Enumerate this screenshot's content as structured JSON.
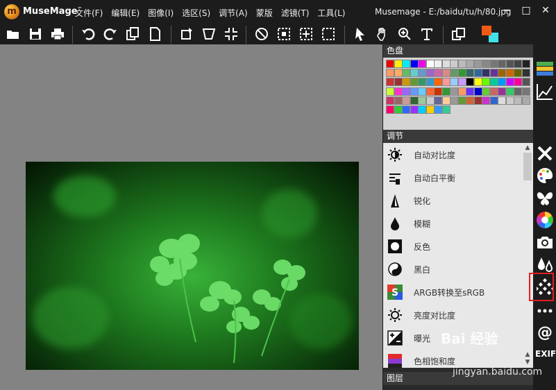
{
  "app": {
    "brand": "MuseMage",
    "tm": "™",
    "logo_letter": "m",
    "window_title": "Musemage - E:/baidu/tu/h/80.jpg"
  },
  "menu": [
    "文件(F)",
    "编辑(E)",
    "图像(I)",
    "选区(S)",
    "调节(A)",
    "蒙版",
    "滤镜(T)",
    "工具(L)"
  ],
  "window_buttons": [
    "minimize-icon",
    "maximize-icon",
    "close-icon"
  ],
  "toolbar_icons": [
    "open-folder-icon",
    "save-icon",
    "print-icon",
    "undo-icon",
    "redo-icon",
    "copy-icon",
    "paste-icon",
    "rotate-icon",
    "transform-icon",
    "resize-icon",
    "deselect-icon",
    "rect-select-icon",
    "move-select-icon",
    "crop-select-icon",
    "pointer-icon",
    "hand-icon",
    "zoom-icon",
    "text-icon",
    "layers-copy-icon",
    "color-swap-icon"
  ],
  "colors": {
    "foreground": "#f05a14",
    "background": "#41e1ec",
    "accent_active": "#e02020"
  },
  "palette_header": "色盘",
  "adjust_header": "调节",
  "layers_header": "图层",
  "adjustments": [
    {
      "label": "自动对比度",
      "icon": "auto-contrast-icon"
    },
    {
      "label": "自动白平衡",
      "icon": "white-balance-icon"
    },
    {
      "label": "锐化",
      "icon": "sharpen-icon"
    },
    {
      "label": "模糊",
      "icon": "blur-icon"
    },
    {
      "label": "反色",
      "icon": "invert-icon"
    },
    {
      "label": "黑白",
      "icon": "black-white-icon"
    },
    {
      "label": "ARGB转换至sRGB",
      "icon": "argb-srgb-icon"
    },
    {
      "label": "亮度对比度",
      "icon": "brightness-contrast-icon"
    },
    {
      "label": "曝光",
      "icon": "exposure-icon"
    },
    {
      "label": "色相饱和度",
      "icon": "hue-saturation-icon"
    }
  ],
  "right_sidebar": [
    "palette-tab-icon",
    "curve-icon",
    "tools-icon",
    "palette-art-icon",
    "butterfly-icon",
    "color-wheel-icon",
    "camera-icon",
    "drops-icon",
    "pattern-icon",
    "more-icon",
    "at-icon"
  ],
  "exif_label": "EXIF",
  "watermark": {
    "text": "Bai 经验",
    "url": "jingyan.baidu.com"
  }
}
